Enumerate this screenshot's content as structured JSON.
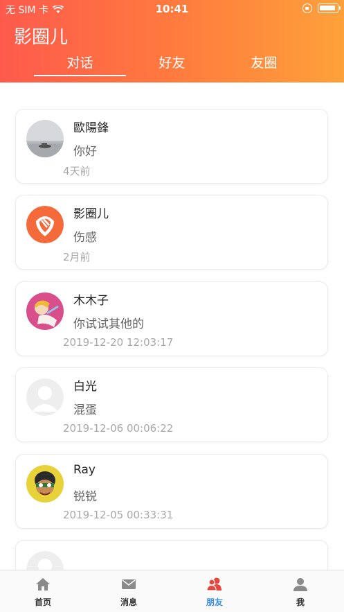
{
  "status_bar": {
    "carrier": "无 SIM 卡",
    "time": "10:41"
  },
  "header": {
    "title": "影圈儿",
    "tabs": [
      {
        "label": "对话",
        "active": true
      },
      {
        "label": "好友",
        "active": false
      },
      {
        "label": "友圈",
        "active": false
      }
    ]
  },
  "conversations": [
    {
      "name": "歐陽鋒",
      "message": "你好",
      "time": "4天前",
      "avatar": "lake-photo"
    },
    {
      "name": "影圈儿",
      "message": "伤感",
      "time": "2月前",
      "avatar": "app-logo"
    },
    {
      "name": "木木子",
      "message": "你试试其他的",
      "time": "2019-12-20 12:03:17",
      "avatar": "anime-photo"
    },
    {
      "name": "白光",
      "message": "混蛋",
      "time": "2019-12-06 00:06:22",
      "avatar": "default-avatar"
    },
    {
      "name": "Ray",
      "message": "锐锐",
      "time": "2019-12-05 00:33:31",
      "avatar": "cartoon-photo"
    },
    {
      "name": "",
      "message": "",
      "time": "",
      "avatar": "default-avatar"
    }
  ],
  "tabbar": {
    "items": [
      {
        "label": "首页",
        "icon": "home-icon",
        "active": false
      },
      {
        "label": "消息",
        "icon": "envelope-icon",
        "active": false
      },
      {
        "label": "朋友",
        "icon": "friends-icon",
        "active": true
      },
      {
        "label": "我",
        "icon": "person-icon",
        "active": false
      }
    ]
  },
  "colors": {
    "header_gradient_start": "#fe5a4c",
    "header_gradient_end": "#fea13a",
    "active_tab": "#e8453c",
    "active_label": "#3a8ee6"
  }
}
